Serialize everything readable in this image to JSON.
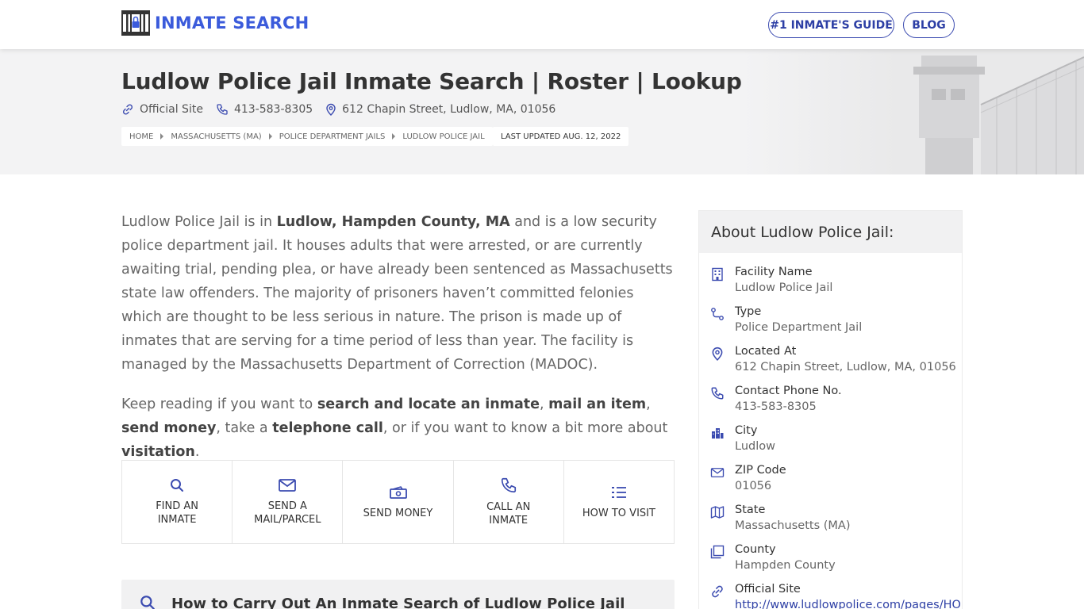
{
  "header": {
    "logo_text": "INMATE SEARCH",
    "nav": [
      {
        "label": "#1 INMATE'S GUIDE"
      },
      {
        "label": "BLOG"
      }
    ]
  },
  "hero": {
    "title": "Ludlow Police Jail Inmate Search | Roster | Lookup",
    "official_site": "Official Site",
    "phone": "413-583-8305",
    "address": "612 Chapin Street, Ludlow, MA, 01056",
    "breadcrumbs": [
      "HOME",
      "MASSACHUSETTS (MA)",
      "POLICE DEPARTMENT JAILS",
      "LUDLOW POLICE JAIL"
    ],
    "last_updated": "LAST UPDATED AUG. 12, 2022"
  },
  "intro": {
    "p1_a": "Ludlow Police Jail is in ",
    "p1_b": "Ludlow, Hampden County, MA",
    "p1_c": " and is a low security police department jail. It houses adults that were arrested, or are currently awaiting trial, pending plea, or have already been sentenced as Massachusetts state law offenders. The majority of prisoners haven’t committed felonies which are thought to be less serious in nature. The prison is made up of inmates that are serving for a time period of less than year. The facility is managed by the Massachusetts Department of Correction (MADOC).",
    "p2_a": "Keep reading if you want to ",
    "p2_b": "search and locate an inmate",
    "p2_c": ", ",
    "p2_d": "mail an item",
    "p2_e": ", ",
    "p2_f": "send money",
    "p2_g": ", take a ",
    "p2_h": "telephone call",
    "p2_i": ", or if you want to know a bit more about ",
    "p2_j": "visitation",
    "p2_k": "."
  },
  "actions": [
    {
      "l1": "FIND AN",
      "l2": "INMATE",
      "icon": "search-icon"
    },
    {
      "l1": "SEND A",
      "l2": "MAIL/PARCEL",
      "icon": "mail-icon"
    },
    {
      "l1": "SEND MONEY",
      "l2": "",
      "icon": "money-icon"
    },
    {
      "l1": "CALL AN",
      "l2": "INMATE",
      "icon": "phone-icon"
    },
    {
      "l1": "HOW TO VISIT",
      "l2": "",
      "icon": "list-icon"
    }
  ],
  "section": {
    "title": "How to Carry Out An Inmate Search of Ludlow Police Jail"
  },
  "sidebar": {
    "title": "About Ludlow Police Jail:",
    "rows": [
      {
        "label": "Facility Name",
        "value": "Ludlow Police Jail",
        "icon": "building-icon"
      },
      {
        "label": "Type",
        "value": "Police Department Jail",
        "icon": "route-icon"
      },
      {
        "label": "Located At",
        "value": "612 Chapin Street, Ludlow, MA, 01056",
        "icon": "map-pin-icon"
      },
      {
        "label": "Contact Phone No.",
        "value": "413-583-8305",
        "icon": "phone-icon"
      },
      {
        "label": "City",
        "value": "Ludlow",
        "icon": "city-icon"
      },
      {
        "label": "ZIP Code",
        "value": "01056",
        "icon": "mail-icon"
      },
      {
        "label": "State",
        "value": "Massachusetts (MA)",
        "icon": "map-icon"
      },
      {
        "label": "County",
        "value": "Hampden County",
        "icon": "copy-icon"
      },
      {
        "label": "Official Site",
        "value": "http://www.ludlowpolice.com/pages/HO",
        "icon": "link-icon"
      }
    ]
  },
  "colors": {
    "accent": "#3b5bdb",
    "nav_border": "#2d3fa5",
    "hero_bg": "#f3f3f4"
  }
}
